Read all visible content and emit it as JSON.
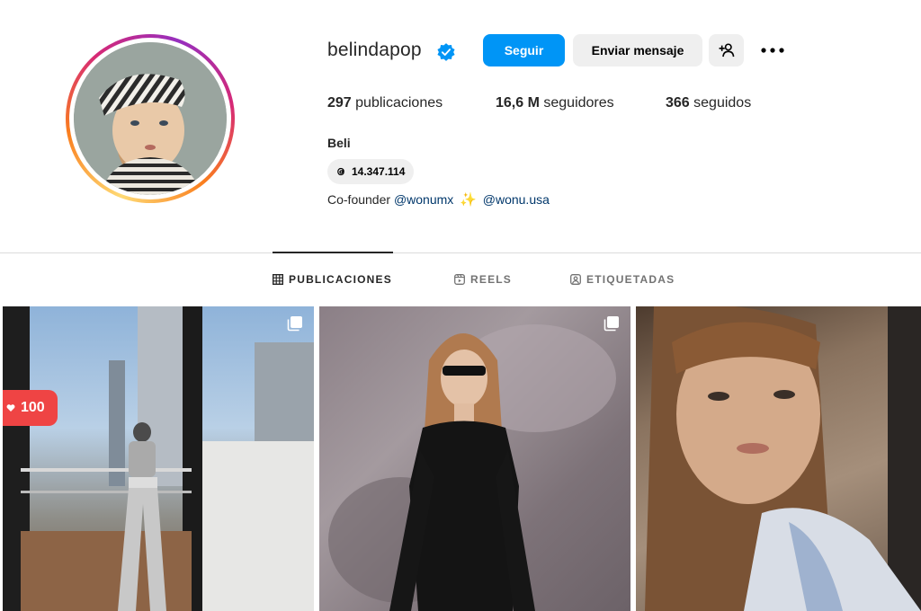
{
  "profile": {
    "username": "belindapop",
    "verified_color": "#0095f6",
    "full_name": "Beli",
    "threads_count": "14.347.114",
    "bio": {
      "text_prefix": "Co-founder",
      "mention_1": "@wonumx",
      "mention_2": "@wonu.usa"
    }
  },
  "buttons": {
    "follow": "Seguir",
    "message": "Enviar mensaje",
    "suggest_icon": "add-person-icon",
    "more_icon": "more-options-icon"
  },
  "stats": {
    "posts_count": "297",
    "posts_label": "publicaciones",
    "followers_count": "16,6 M",
    "followers_label": "seguidores",
    "following_count": "366",
    "following_label": "seguidos"
  },
  "tabs": [
    {
      "label": "PUBLICACIONES",
      "icon": "grid-icon",
      "active": true
    },
    {
      "label": "REELS",
      "icon": "reels-icon",
      "active": false
    },
    {
      "label": "ETIQUETADAS",
      "icon": "tagged-icon",
      "active": false
    }
  ],
  "posts": [
    {
      "type": "carousel",
      "likes_badge": "100"
    },
    {
      "type": "carousel"
    },
    {
      "type": "video"
    }
  ],
  "colors": {
    "primary_button": "#0095f6",
    "secondary_button": "#efefef",
    "likes_badge": "#ef4444",
    "mention": "#00376b"
  }
}
